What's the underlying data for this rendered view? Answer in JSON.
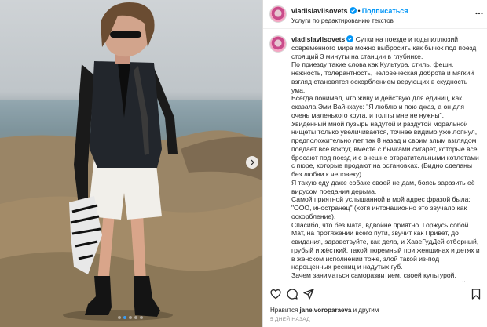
{
  "colors": {
    "accent": "#0095f6",
    "carousel_active": "#3b9cf5",
    "muted": "#8e8e8e"
  },
  "photo": {
    "carousel_total": 5,
    "carousel_active_index": 1,
    "alt_icon": "chevron-right-icon"
  },
  "header": {
    "username": "vladislavlisovets",
    "separator": "•",
    "follow_label": "Подписаться",
    "subtitle": "Услуги по редактированию текстов",
    "more_icon": "more-horizontal-icon"
  },
  "caption": {
    "username": "vladislavlisovets",
    "paragraphs": [
      "Сутки на поезде и годы иллюзий современного мира можно выбросить как бычок под поезд стоящий 3 минуты на станции в глубинке.",
      "По приезду такие слова как Культура, стиль, фешн, нежность, толерантность, человеческая доброта и мягкий взгляд становятся оскорблением верующих в скудность ума.",
      "Всегда понимал, что живу и действую для единиц, как сказала Эми Вайнхаус: \"Я люблю и пою джаз, а он для очень маленького круга, и толпы мне не нужны\".",
      "Увиденный мной пузырь надутой и раздутой моральной нищеты только увеличивается, точнее видимо уже лопнул, предположительно лет так 8 назад и своим злым взглядом поедает всё вокруг, вместе с бычками сигарет, которые все бросают под поезд и с внешне отвратительными котлетами с пюре, которые продают на остановках. (Видно сделаны без любви к человеку)",
      "Я такую еду даже собаке своей не дам, боясь заразить её вирусом поедания дерьма.",
      "Самой приятной услышанной в мой адрес фразой была: \"ООО, иностранец\" (хотя интонационно это звучало как оскорбление).",
      "Спасибо, что без мата, вдвойне приятно. Горжусь собой. Мат, на протяжении всего пути, звучит как Привет, до свидания, здравствуйте, как дела, и ХавеГудДей отборный, грубый и жёсткий, такой тюремный при женщинах и детях и в женском исполнении тоже, злой такой из-под нарощенных ресниц и надутых губ.",
      "Зачем заниматься саморазвитием, своей культурой, внешним видом, кушать красиво (прим. Только грудной"
    ]
  },
  "actions": {
    "icons": [
      "heart-icon",
      "comment-icon",
      "share-icon",
      "bookmark-icon"
    ],
    "liked_prefix": "Нравится",
    "liked_user": "jane.voroparaeva",
    "liked_suffix": "и другим",
    "time_ago": "5 ДНЕЙ НАЗАД"
  }
}
